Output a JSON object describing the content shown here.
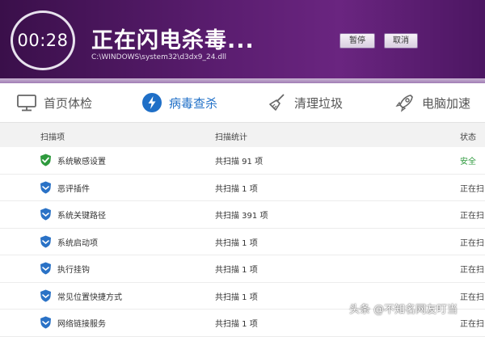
{
  "header": {
    "timer": "00:28",
    "title": "正在闪电杀毒...",
    "current_file": "C:\\WINDOWS\\system32\\d3dx9_24.dll",
    "pause_label": "暂停",
    "cancel_label": "取消"
  },
  "tabs": [
    {
      "label": "首页体检",
      "icon": "monitor-icon",
      "active": false
    },
    {
      "label": "病毒查杀",
      "icon": "lightning-icon",
      "active": true
    },
    {
      "label": "清理垃圾",
      "icon": "broom-icon",
      "active": false
    },
    {
      "label": "电脑加速",
      "icon": "rocket-icon",
      "active": false
    }
  ],
  "table": {
    "columns": [
      "扫描项",
      "扫描统计",
      "状态"
    ],
    "rows": [
      {
        "name": "系统敏感设置",
        "stat": "共扫描 91 项",
        "status": "安全",
        "status_type": "safe",
        "icon": "shield-check-icon"
      },
      {
        "name": "恶评插件",
        "stat": "共扫描 1 项",
        "status": "正在扫",
        "status_type": "scanning",
        "icon": "shield-icon"
      },
      {
        "name": "系统关键路径",
        "stat": "共扫描 391 项",
        "status": "正在扫",
        "status_type": "scanning",
        "icon": "shield-icon"
      },
      {
        "name": "系统启动项",
        "stat": "共扫描 1 项",
        "status": "正在扫",
        "status_type": "scanning",
        "icon": "shield-icon"
      },
      {
        "name": "执行挂钩",
        "stat": "共扫描 1 项",
        "status": "正在扫",
        "status_type": "scanning",
        "icon": "shield-icon"
      },
      {
        "name": "常见位置快捷方式",
        "stat": "共扫描 1 项",
        "status": "正在扫",
        "status_type": "scanning",
        "icon": "shield-icon"
      },
      {
        "name": "网络链接服务",
        "stat": "共扫描 1 项",
        "status": "正在扫",
        "status_type": "scanning",
        "icon": "shield-icon"
      }
    ]
  },
  "watermark": "头条 @不知名网友叮当",
  "colors": {
    "header_bg": "#5a1d6f",
    "accent_blue": "#1f6fc7",
    "safe_green": "#2e9a3d"
  }
}
